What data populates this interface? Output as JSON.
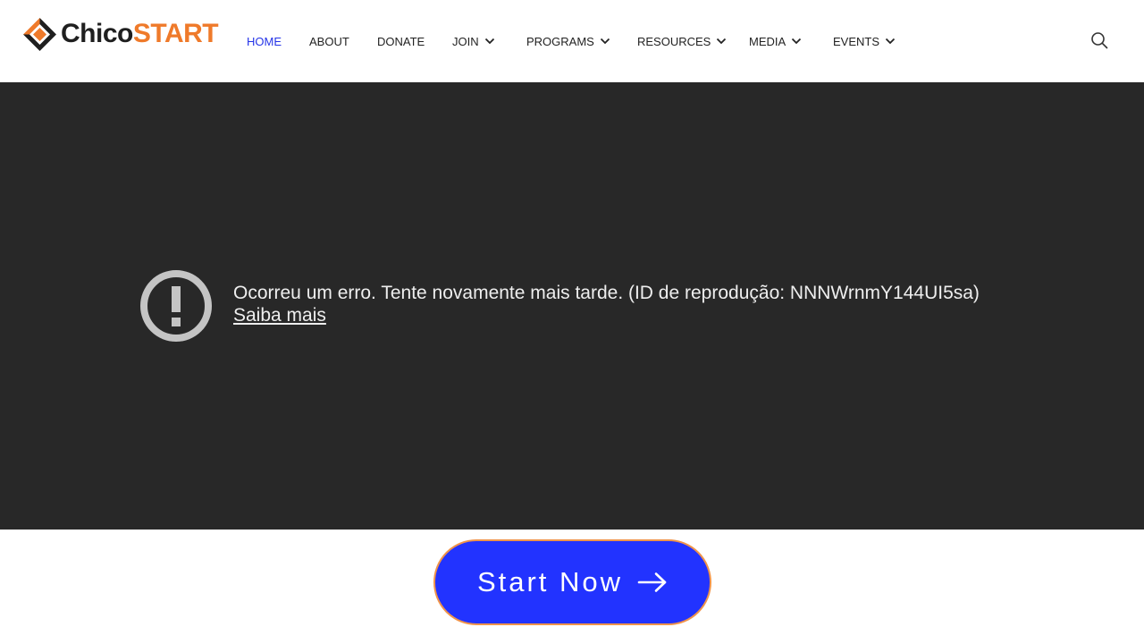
{
  "header": {
    "logo": {
      "part1": "Chico",
      "part2": "START",
      "icon": "chicostart-logo-icon"
    },
    "nav": [
      {
        "label": "HOME",
        "active": true,
        "dropdown": false
      },
      {
        "label": "ABOUT",
        "active": false,
        "dropdown": false
      },
      {
        "label": "DONATE",
        "active": false,
        "dropdown": false
      },
      {
        "label": "JOIN",
        "active": false,
        "dropdown": true
      },
      {
        "label": "PROGRAMS",
        "active": false,
        "dropdown": true
      },
      {
        "label": "RESOURCES",
        "active": false,
        "dropdown": true
      },
      {
        "label": "MEDIA",
        "active": false,
        "dropdown": true
      },
      {
        "label": "EVENTS",
        "active": false,
        "dropdown": true
      }
    ],
    "search_icon": "search-icon"
  },
  "video": {
    "error_icon": "exclamation-circle-icon",
    "error_message": "Ocorreu um erro. Tente novamente mais tarde. (ID de reprodução: NNNWrnmY144UI5sa)",
    "learn_more": "Saiba mais"
  },
  "cta": {
    "label": "Start Now",
    "icon": "arrow-right-icon"
  },
  "colors": {
    "accent_orange": "#ef7a2a",
    "active_nav": "#2534e8",
    "cta_blue": "#2233ff",
    "video_bg": "#282828"
  }
}
